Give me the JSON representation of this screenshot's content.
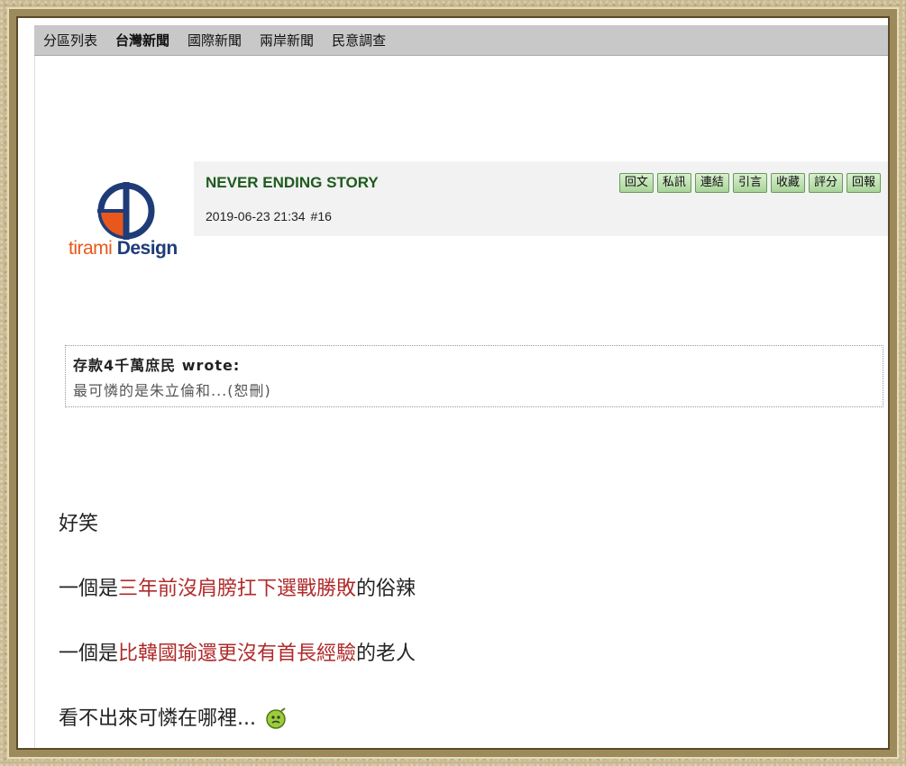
{
  "nav": {
    "items": [
      {
        "label": "分區列表",
        "active": false
      },
      {
        "label": "台灣新聞",
        "active": true
      },
      {
        "label": "國際新聞",
        "active": false
      },
      {
        "label": "兩岸新聞",
        "active": false
      },
      {
        "label": "民意調查",
        "active": false
      }
    ]
  },
  "logo": {
    "text_a": "tirami",
    "text_b": "Design",
    "colors": {
      "orange": "#e8581c",
      "blue": "#1f3c78"
    }
  },
  "post": {
    "author": "NEVER ENDING STORY",
    "datetime": "2019-06-23 21:34",
    "number": "#16",
    "buttons": [
      "回文",
      "私訊",
      "連結",
      "引言",
      "收藏",
      "評分",
      "回報"
    ]
  },
  "quote": {
    "author": "存款4千萬庶民 wrote:",
    "body": "最可憐的是朱立倫和...(恕刪)"
  },
  "body": {
    "line1": "好笑",
    "line2_pre": "一個是",
    "line2_red": "三年前沒肩膀扛下選戰勝敗",
    "line2_post": "的俗辣",
    "line3_pre": "一個是",
    "line3_red": "比韓國瑜還更沒有首長經驗",
    "line3_post": "的老人",
    "line4": "看不出來可憐在哪裡...",
    "emoji": "smirk-emoji-icon"
  },
  "colors": {
    "accent_red": "#b02a2a",
    "author_green": "#1e5a1e",
    "button_green": "#a9d49a"
  }
}
